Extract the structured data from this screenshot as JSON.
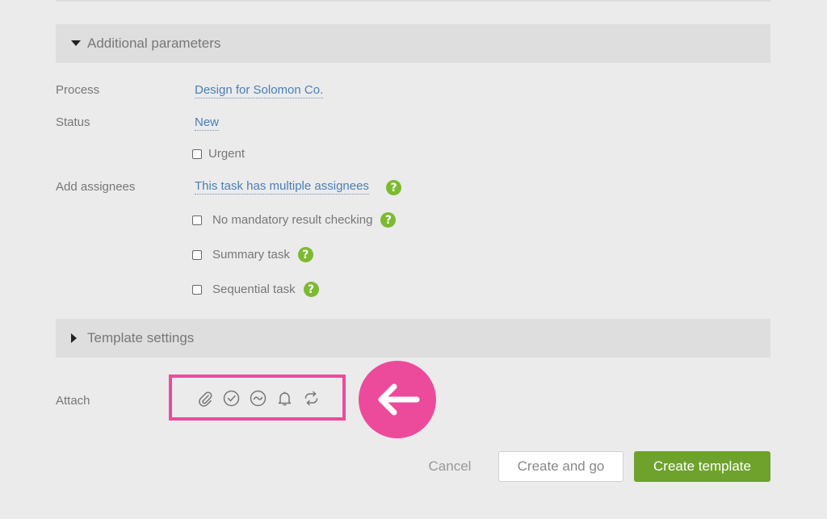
{
  "additional_parameters": {
    "title": "Additional parameters"
  },
  "fields": {
    "process": {
      "label": "Process",
      "value": "Design for Solomon Co."
    },
    "status": {
      "label": "Status",
      "value": "New"
    },
    "urgent": {
      "label": "Urgent",
      "checked": false
    },
    "assignees": {
      "label": "Add assignees",
      "value": "This task has multiple assignees"
    },
    "no_mandatory": {
      "label": "No mandatory result checking",
      "checked": false
    },
    "summary_task": {
      "label": "Summary task",
      "checked": false
    },
    "sequential_task": {
      "label": "Sequential task",
      "checked": false
    }
  },
  "help_icon": {
    "glyph": "?"
  },
  "template_settings": {
    "title": "Template settings"
  },
  "attach": {
    "label": "Attach",
    "icons": [
      "paperclip-icon",
      "check-circle-icon",
      "wave-circle-icon",
      "bell-icon",
      "repeat-icon"
    ]
  },
  "buttons": {
    "cancel": "Cancel",
    "create_and_go": "Create and go",
    "create_template": "Create template"
  },
  "colors": {
    "highlight": "#ec4b9c",
    "link": "#4a7fb5",
    "help": "#7cba31",
    "primary": "#6ea22d"
  }
}
